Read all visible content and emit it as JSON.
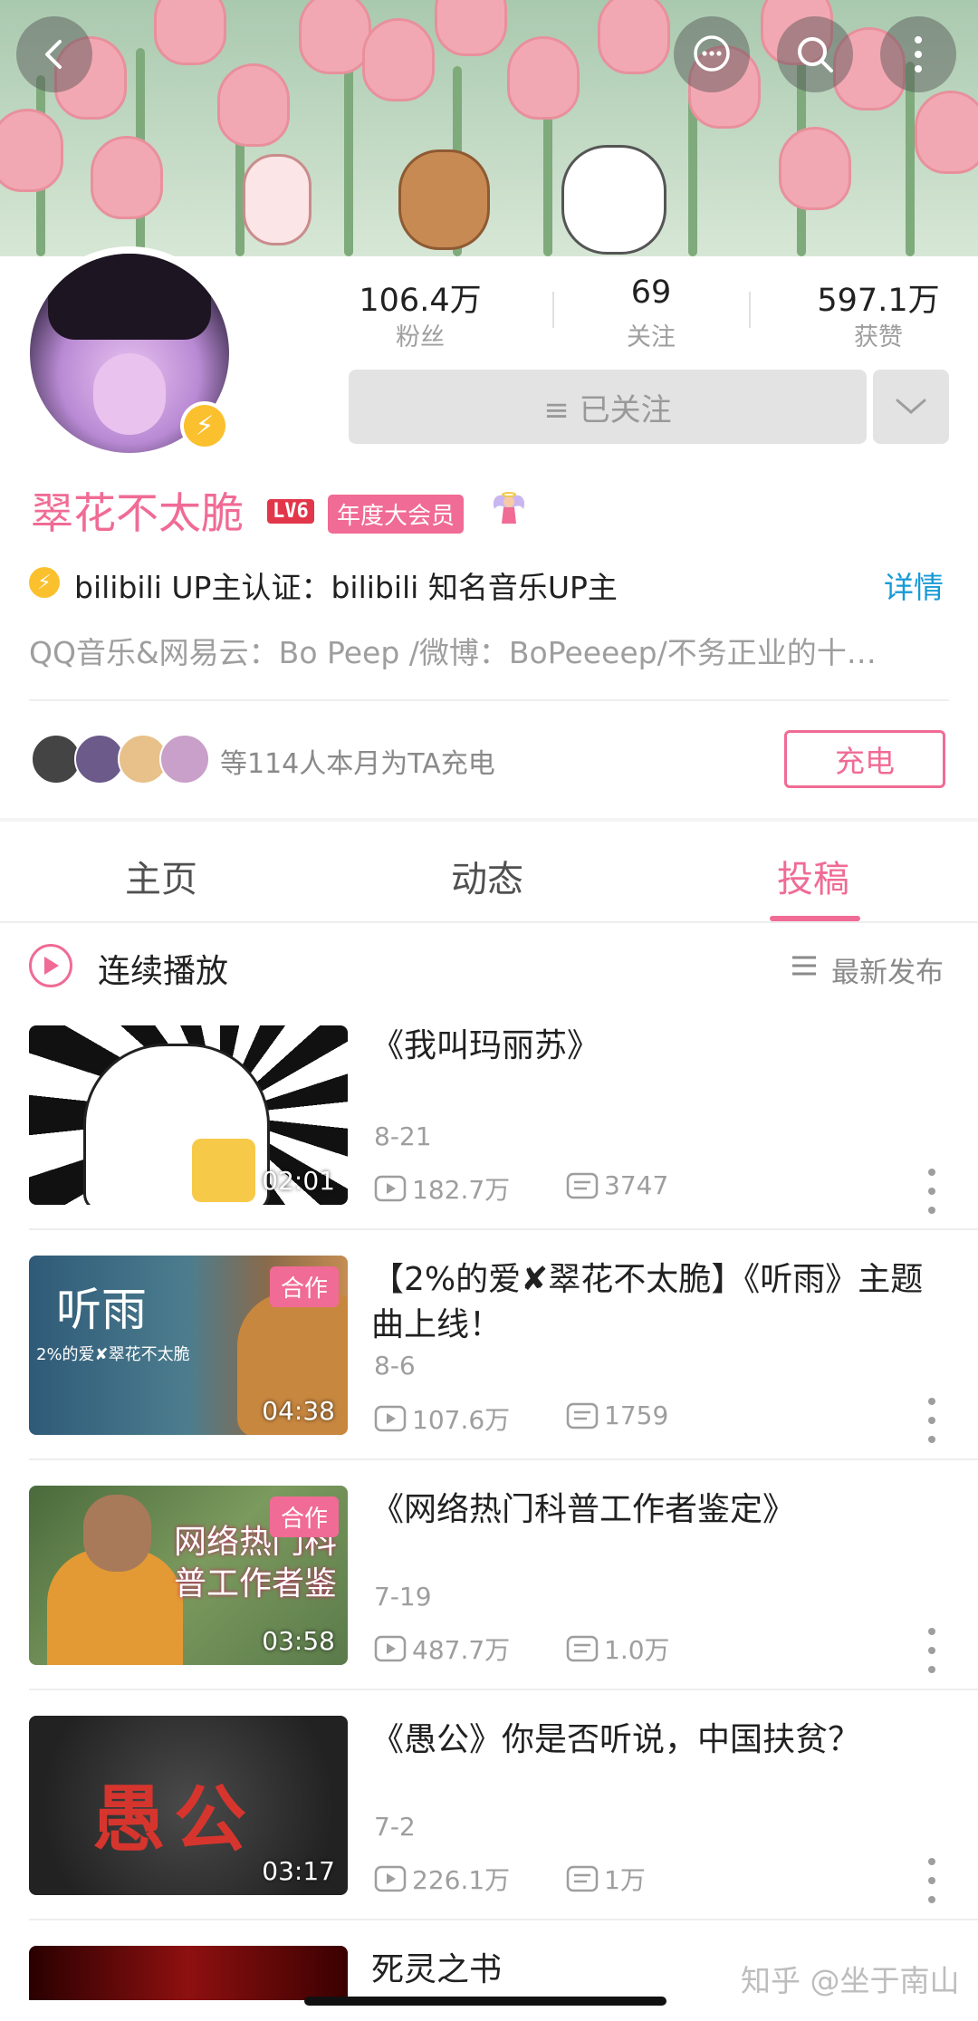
{
  "header": {
    "back_icon": "chevron-left-icon",
    "message_icon": "chat-bubble-icon",
    "search_icon": "search-icon",
    "more_icon": "more-vertical-icon"
  },
  "stats": {
    "fans_value": "106.4万",
    "fans_label": "粉丝",
    "following_value": "69",
    "following_label": "关注",
    "likes_value": "597.1万",
    "likes_label": "获赞"
  },
  "follow": {
    "label": "≡ 已关注"
  },
  "profile": {
    "name": "翠花不太脆",
    "level": "LV6",
    "vip": "年度大会员",
    "cert_text": "bilibili UP主认证：bilibili 知名音乐UP主",
    "detail_link": "详情",
    "signature": "QQ音乐&网易云：Bo Peep /微博：BoPeeeep/不务正业的十…"
  },
  "charge": {
    "text": "等114人本月为TA充电",
    "button": "充电"
  },
  "tabs": {
    "home": "主页",
    "dynamic": "动态",
    "posts": "投稿"
  },
  "list_header": {
    "play_all": "连续播放",
    "sort": "最新发布"
  },
  "videos": [
    {
      "title": "《我叫玛丽苏》",
      "date": "8-21",
      "views": "182.7万",
      "comments": "3747",
      "duration": "02:01",
      "collab": ""
    },
    {
      "title": "【2%的爱✘翠花不太脆】《听雨》主题曲上线！",
      "date": "8-6",
      "views": "107.6万",
      "comments": "1759",
      "duration": "04:38",
      "collab": "合作"
    },
    {
      "title": "《网络热门科普工作者鉴定》",
      "date": "7-19",
      "views": "487.7万",
      "comments": "1.0万",
      "duration": "03:58",
      "collab": "合作"
    },
    {
      "title": "《愚公》你是否听说，中国扶贫？",
      "date": "7-2",
      "views": "226.1万",
      "comments": "1万",
      "duration": "03:17",
      "collab": ""
    },
    {
      "title": "死灵之书"
    }
  ],
  "thumb_text": {
    "v2_title": "听雨",
    "v2_sub": "2%的爱✘翠花不太脆",
    "v3_title": "网络热门科普工作者鉴",
    "v4_title": "愚公"
  },
  "watermark": "知乎 @坐于南山",
  "colors": {
    "accent": "#f06b95",
    "link": "#179ad6",
    "gold": "#fbc02d"
  }
}
